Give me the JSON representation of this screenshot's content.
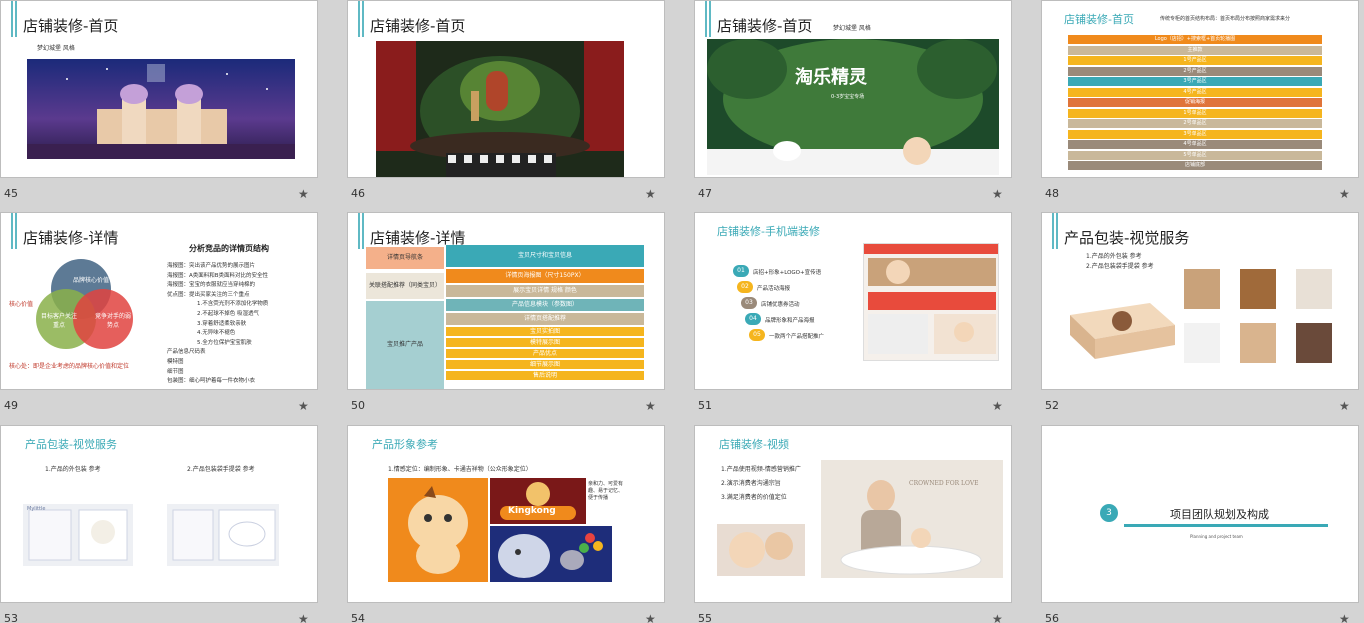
{
  "slides": [
    {
      "num": "45",
      "title": "店铺装修-首页",
      "sub": "梦幻城堡 风格"
    },
    {
      "num": "46",
      "title": "店铺装修-首页"
    },
    {
      "num": "47",
      "title": "店铺装修-首页",
      "sub": "梦幻城堡 风格",
      "banner_text": "淘乐精灵",
      "banner_sub": "0-3岁宝宝专场"
    },
    {
      "num": "48",
      "title": "店铺装修-首页",
      "note": "传统专柜的首页结构布局：首页布局分布按照商家需求来分",
      "rows": [
        "Logo（店招）+搜索框+首页轮播图",
        "主推款",
        "1号产品区",
        "2号产品区",
        "3号产品区",
        "4号产品区",
        "促销海报",
        "1号单品区",
        "2号单品区",
        "3号单品区",
        "4号单品区",
        "5号单品区",
        "店铺底部"
      ]
    },
    {
      "num": "49",
      "title": "店铺装修-详情",
      "analysis_title": "分析竞品的详情页结构",
      "venn": [
        "品牌核心价值",
        "目标客户关注重点",
        "竞争对手的弱势点"
      ],
      "core_label": "核心价值",
      "core_text": "核心处：即是企业考虑的品牌核心价值和定位",
      "lines": [
        "海报图：突出该产品优势的展示图片",
        "海报图：A类面料和B类面料对比的安全性",
        "海报图：宝宝的衣服就应当穿纯棉的",
        "优点图：提出买家关注的三个重点",
        "1.不含荧光剂不添加化学物质",
        "2.不起球不掉色 吸湿透气",
        "3.穿着舒适柔软亲肤",
        "4.无异味不褪色",
        "5.全方位保护宝宝肌肤",
        "产品信息尺码表",
        "模特图",
        "细节图",
        "包装图：细心呵护着每一件衣物小衣"
      ]
    },
    {
      "num": "50",
      "title": "店铺装修-详情",
      "left_boxes": [
        "详情页导航条",
        "关联搭配推荐（同类宝贝）",
        "宝贝推广产品"
      ],
      "right_boxes": [
        "宝贝尺寸和宝贝信息",
        "详情页海报图（尺寸150PX）",
        "展示宝贝详情 规格 颜色",
        "产品信息模块（参数图）",
        "详情页搭配推荐",
        "宝贝实拍图",
        "模特展示图",
        "产品优点",
        "细节展示图",
        "售后说明"
      ]
    },
    {
      "num": "51",
      "title": "店铺装修-手机端装修",
      "steps": [
        {
          "n": "01",
          "t": "店招+形象+LOGO+宣传语"
        },
        {
          "n": "02",
          "t": "产品活动海报"
        },
        {
          "n": "03",
          "t": "店铺优惠券活动"
        },
        {
          "n": "04",
          "t": "品牌形象和产品海报"
        },
        {
          "n": "05",
          "t": "一款两个产品搭配推广"
        }
      ]
    },
    {
      "num": "52",
      "title": "产品包装-视觉服务",
      "items": [
        "1.产品的外包装 参考",
        "2.产品包装袋手提袋 参考"
      ]
    },
    {
      "num": "53",
      "title": "产品包装-视觉服务",
      "items": [
        "1.产品的外包装 参考",
        "2.产品包装袋手提袋 参考"
      ],
      "brand": "Mylittle"
    },
    {
      "num": "54",
      "title": "产品形象参考",
      "desc": "1.情感定位：编制形象、卡通吉祥物（公众形象定位）",
      "kingkong": "Kingkong",
      "side_text": "亲和力、可爱有趣、易于记忆、便于传播"
    },
    {
      "num": "55",
      "title": "店铺装修-视频",
      "items": [
        "1.产品使用视频-情感营销推广",
        "2.演示消费者沟通宗旨",
        "3.满足消费者的价值定位"
      ],
      "photo_text": "CROWNED FOR LOVE"
    },
    {
      "num": "56",
      "section_num": "3",
      "section_title": "项目团队规划及构成",
      "section_en": "Planning and project team"
    }
  ],
  "colors": {
    "accent": "#5fb9c4",
    "orange": "#f08a1c",
    "yellow": "#f5b51e",
    "teal": "#3aa9b6"
  },
  "icons": {
    "star": "★"
  }
}
